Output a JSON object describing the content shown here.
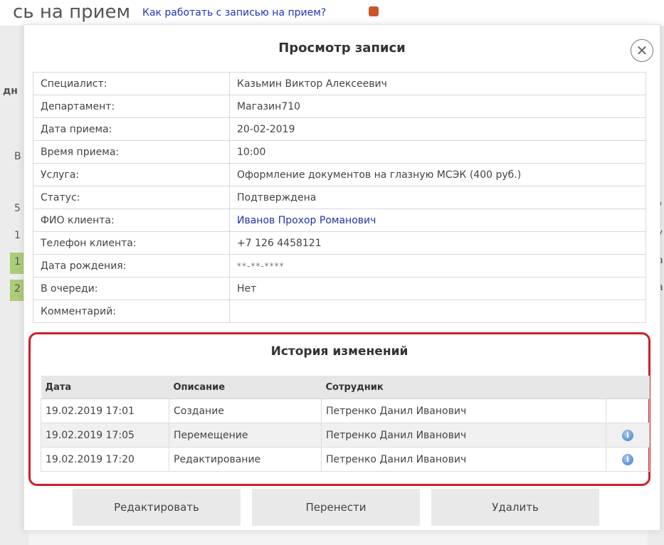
{
  "background": {
    "page_title": "сь на прием",
    "help_link": "Как работать с записью на прием?",
    "fragments": [
      "дн",
      "В",
      "5",
      "1",
      "1",
      "2",
      "го",
      "ау",
      "на",
      "на"
    ]
  },
  "modal": {
    "title": "Просмотр записи",
    "close_icon": "close-circle-icon",
    "details": [
      {
        "label": "Специалист:",
        "value": "Казьмин Виктор Алексеевич"
      },
      {
        "label": "Департамент:",
        "value": "Магазин710"
      },
      {
        "label": "Дата приема:",
        "value": "20-02-2019"
      },
      {
        "label": "Время приема:",
        "value": "10:00"
      },
      {
        "label": "Услуга:",
        "value": "Оформление документов на глазную МСЭК (400 руб.)"
      },
      {
        "label": "Статус:",
        "value": "Подтверждена"
      },
      {
        "label": "ФИО клиента:",
        "value": "Иванов Прохор Романович"
      },
      {
        "label": "Телефон клиента:",
        "value": "+7 126 4458121"
      },
      {
        "label": "Дата рождения:",
        "value": "**-**-****"
      },
      {
        "label": "В очереди:",
        "value": "Нет"
      },
      {
        "label": "Комментарий:",
        "value": ""
      }
    ],
    "history": {
      "title": "История изменений",
      "columns": [
        "Дата",
        "Описание",
        "Сотрудник",
        ""
      ],
      "rows": [
        {
          "date": "19.02.2019 17:01",
          "description": "Создание",
          "employee": "Петренко Данил Иванович",
          "info": ""
        },
        {
          "date": "19.02.2019 17:05",
          "description": "Перемещение",
          "employee": "Петренко Данил Иванович",
          "info": "i"
        },
        {
          "date": "19.02.2019 17:20",
          "description": "Редактирование",
          "employee": "Петренко Данил Иванович",
          "info": "i"
        }
      ]
    },
    "buttons": {
      "edit": "Редактировать",
      "move": "Перенести",
      "delete": "Удалить"
    }
  },
  "colors": {
    "highlight_border": "#cc1f2a",
    "link": "#2233aa",
    "info_icon": "#3f78c9"
  }
}
